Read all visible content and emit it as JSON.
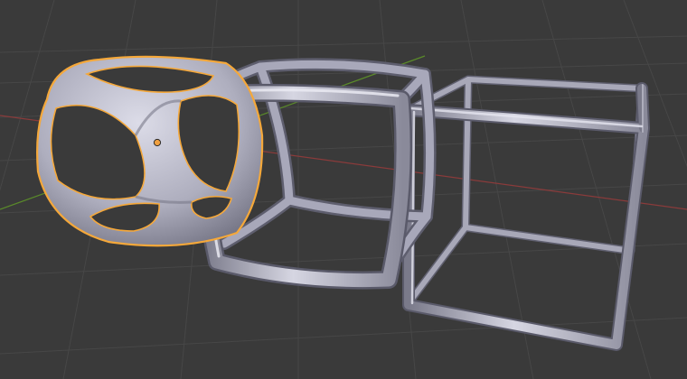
{
  "colors": {
    "background": "#3a3a3a",
    "grid": "#474747",
    "x_axis": "#8a3b3b",
    "y_axis": "#5a8a2a",
    "mesh_fill": "#b4b4c4",
    "mesh_light": "#d8d8e4",
    "mesh_dark": "#6c6c7c",
    "selection_outline": "#f5a83a",
    "origin_dot": "#f0a040"
  },
  "viewport": {
    "objects": [
      {
        "id": "subsurf-sphere-cube",
        "selected": true
      },
      {
        "id": "rounded-wireframe-cube",
        "selected": false
      },
      {
        "id": "thin-wireframe-cube",
        "selected": false
      }
    ]
  }
}
